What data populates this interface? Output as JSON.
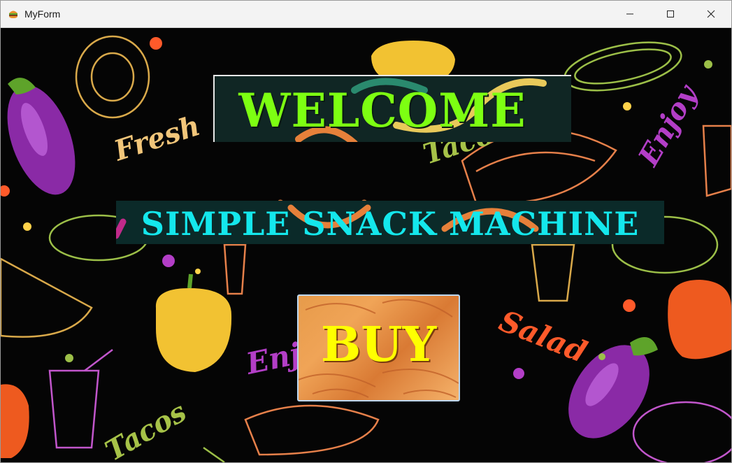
{
  "window": {
    "title": "MyForm",
    "icon": "burger-icon"
  },
  "controls": {
    "minimize": "minimize-icon",
    "maximize": "maximize-icon",
    "close": "close-icon"
  },
  "main": {
    "welcome": "WELCOME",
    "heading": "SIMPLE SNACK MACHINE",
    "buy_label": "BUY"
  },
  "background_words": [
    "Fresh",
    "Tacos",
    "Enjoy",
    "Salad",
    "Enjoy",
    "Tacos"
  ],
  "colors": {
    "welcome_text": "#7dff12",
    "heading_text": "#14e7ec",
    "buy_text": "#ffff00",
    "panel_bg": "#102624"
  }
}
